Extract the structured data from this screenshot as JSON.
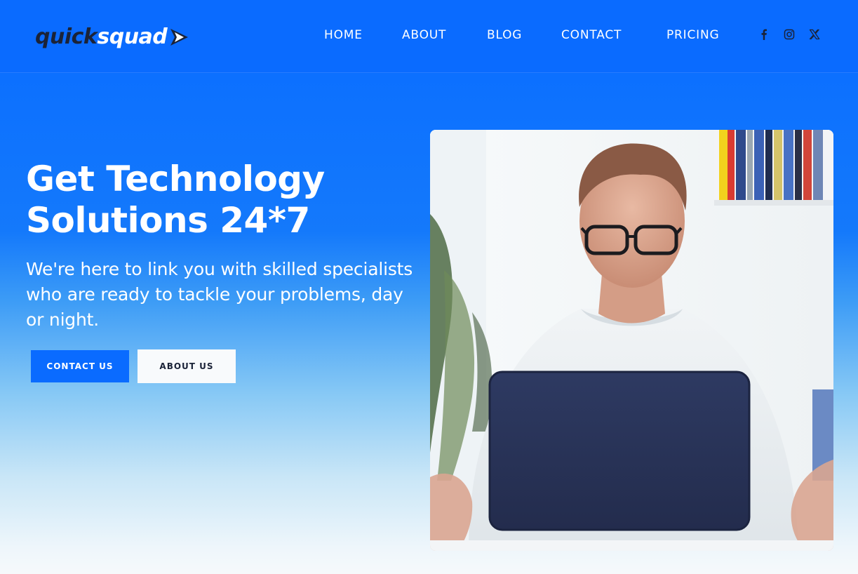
{
  "brand": {
    "logo_part1": "quick",
    "logo_part2": "squad",
    "logo_icon": "play-arrow-icon"
  },
  "nav": {
    "items": [
      {
        "label": "HOME"
      },
      {
        "label": "ABOUT"
      },
      {
        "label": "BLOG"
      },
      {
        "label": "CONTACT"
      },
      {
        "label": "PRICING"
      }
    ],
    "social": [
      {
        "icon": "facebook-icon"
      },
      {
        "icon": "instagram-icon"
      },
      {
        "icon": "x-twitter-icon"
      }
    ]
  },
  "hero": {
    "title_line1": "Get Technology",
    "title_line2": "Solutions 24*7",
    "subtitle_line1": "We're here to link you with skilled specialists",
    "subtitle_line2": "who are ready to tackle your problems, day",
    "subtitle_line3": "or night.",
    "primary_button": "CONTACT US",
    "secondary_button": "ABOUT US",
    "image": "man-working-on-laptop-photo"
  },
  "colors": {
    "primary": "#0a6bff",
    "dark": "#1b2338",
    "white": "#ffffff"
  }
}
